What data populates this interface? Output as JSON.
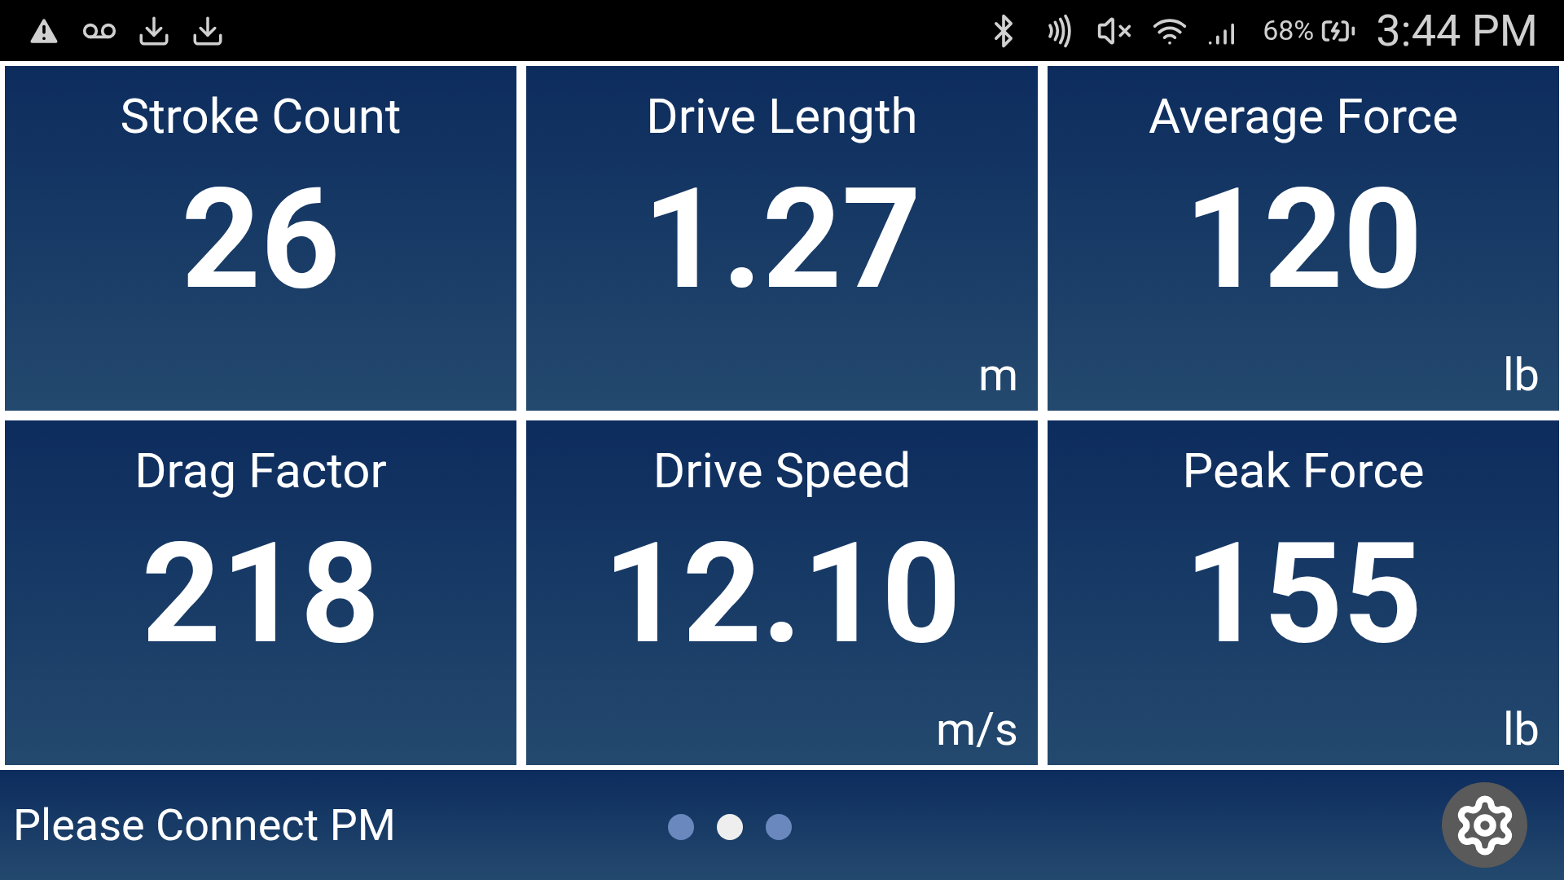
{
  "status_bar": {
    "battery": "68%",
    "time": "3:44 PM"
  },
  "tiles": [
    {
      "label": "Stroke Count",
      "value": "26"
    },
    {
      "label": "Drive Length",
      "value": "1.27",
      "unit": "m"
    },
    {
      "label": "Average Force",
      "value": "120",
      "unit": "lb"
    },
    {
      "label": "Drag Factor",
      "value": "218"
    },
    {
      "label": "Drive Speed",
      "value": "12.10",
      "unit": "m/s"
    },
    {
      "label": "Peak Force",
      "value": "155",
      "unit": "lb"
    }
  ],
  "footer": {
    "message": "Please Connect PM",
    "pages": [
      {
        "selected": false
      },
      {
        "selected": true
      },
      {
        "selected": false
      }
    ]
  }
}
